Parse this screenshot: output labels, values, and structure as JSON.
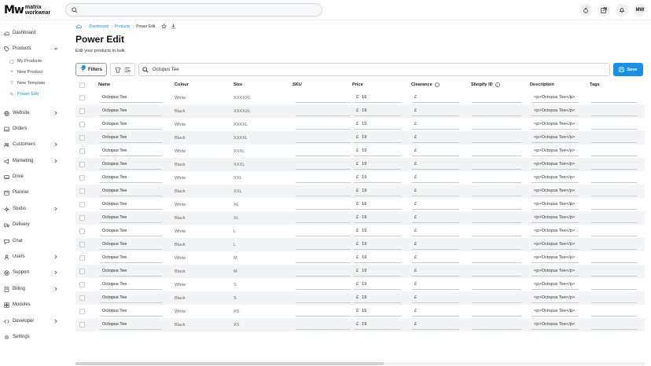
{
  "brand": {
    "mark": "Mw",
    "line1": "matrix",
    "line2": "workwear"
  },
  "header": {
    "avatar": "MW",
    "icons": [
      "ai-icon",
      "external-link-icon",
      "bell-icon"
    ]
  },
  "sidebar": {
    "items": [
      {
        "label": "Dashboard",
        "icon": "cloud-icon"
      },
      {
        "label": "Products",
        "icon": "tag-icon",
        "expanded": true
      },
      {
        "label": "Website",
        "icon": "globe-icon",
        "chevron": true
      },
      {
        "label": "Orders",
        "icon": "inbox-icon"
      },
      {
        "label": "Customers",
        "icon": "customers-icon",
        "chevron": true
      },
      {
        "label": "Marketing",
        "icon": "megaphone-icon",
        "chevron": true
      },
      {
        "label": "Drive",
        "icon": "drive-icon"
      },
      {
        "label": "Planner",
        "icon": "calendar-icon"
      },
      {
        "label": "Studio",
        "icon": "studio-icon",
        "chevron": true
      },
      {
        "label": "Delivery",
        "icon": "truck-icon"
      },
      {
        "label": "Chat",
        "icon": "chat-icon"
      },
      {
        "label": "Users",
        "icon": "users-icon",
        "chevron": true
      },
      {
        "label": "Support",
        "icon": "support-icon",
        "chevron": true
      },
      {
        "label": "Billing",
        "icon": "billing-icon",
        "chevron": true
      },
      {
        "label": "Modules",
        "icon": "modules-icon"
      },
      {
        "label": "Developer",
        "icon": "code-icon",
        "chevron": true
      },
      {
        "label": "Settings",
        "icon": "gear-icon"
      }
    ],
    "products_sub": [
      {
        "label": "My Products",
        "icon": "box-icon"
      },
      {
        "label": "New Product",
        "icon": "plus-icon"
      },
      {
        "label": "New Template",
        "icon": "template-icon"
      },
      {
        "label": "Power Edit",
        "icon": "power-edit-icon",
        "active": true
      }
    ]
  },
  "breadcrumb": {
    "home_icon": "cloud-icon",
    "items": [
      "Dashboard",
      "Products"
    ],
    "current": "Power Edit"
  },
  "page": {
    "title": "Power Edit",
    "subtitle": "Edit your products in bulk"
  },
  "toolbar": {
    "filters_label": "Filters",
    "filters_badge": "1",
    "search_value": "Octopus Tee",
    "save_label": "Save"
  },
  "table": {
    "columns": [
      "Name",
      "Colour",
      "Size",
      "SKU",
      "Price",
      "Clearance",
      "Shopify ID",
      "Description",
      "Tags"
    ],
    "currency": "£",
    "rows": [
      {
        "name": "Octopus Tee",
        "colour": "White",
        "size": "XXXXXL",
        "price": "19",
        "clearance": "",
        "description": "<p>Octopus Tee</p>"
      },
      {
        "name": "Octopus Tee",
        "colour": "Black",
        "size": "XXXXXL",
        "price": "19",
        "clearance": "",
        "description": "<p>Octopus Tee</p>"
      },
      {
        "name": "Octopus Tee",
        "colour": "White",
        "size": "XXXXL",
        "price": "19",
        "clearance": "",
        "description": "<p>Octopus Tee</p>"
      },
      {
        "name": "Octopus Tee",
        "colour": "Black",
        "size": "XXXXL",
        "price": "19",
        "clearance": "",
        "description": "<p>Octopus Tee</p>"
      },
      {
        "name": "Octopus Tee",
        "colour": "White",
        "size": "XXXL",
        "price": "19",
        "clearance": "",
        "description": "<p>Octopus Tee</p>"
      },
      {
        "name": "Octopus Tee",
        "colour": "Black",
        "size": "XXXL",
        "price": "19",
        "clearance": "",
        "description": "<p>Octopus Tee</p>"
      },
      {
        "name": "Octopus Tee",
        "colour": "White",
        "size": "XXL",
        "price": "19",
        "clearance": "",
        "description": "<p>Octopus Tee</p>"
      },
      {
        "name": "Octopus Tee",
        "colour": "Black",
        "size": "XXL",
        "price": "19",
        "clearance": "",
        "description": "<p>Octopus Tee</p>"
      },
      {
        "name": "Octopus Tee",
        "colour": "White",
        "size": "XL",
        "price": "19",
        "clearance": "",
        "description": "<p>Octopus Tee</p>"
      },
      {
        "name": "Octopus Tee",
        "colour": "Black",
        "size": "XL",
        "price": "19",
        "clearance": "",
        "description": "<p>Octopus Tee</p>"
      },
      {
        "name": "Octopus Tee",
        "colour": "White",
        "size": "L",
        "price": "19",
        "clearance": "",
        "description": "<p>Octopus Tee</p>"
      },
      {
        "name": "Octopus Tee",
        "colour": "Black",
        "size": "L",
        "price": "19",
        "clearance": "",
        "description": "<p>Octopus Tee</p>"
      },
      {
        "name": "Octopus Tee",
        "colour": "White",
        "size": "M",
        "price": "19",
        "clearance": "",
        "description": "<p>Octopus Tee</p>"
      },
      {
        "name": "Octopus Tee",
        "colour": "Black",
        "size": "M",
        "price": "19",
        "clearance": "",
        "description": "<p>Octopus Tee</p>"
      },
      {
        "name": "Octopus Tee",
        "colour": "White",
        "size": "S",
        "price": "19",
        "clearance": "",
        "description": "<p>Octopus Tee</p>"
      },
      {
        "name": "Octopus Tee",
        "colour": "Black",
        "size": "S",
        "price": "19",
        "clearance": "",
        "description": "<p>Octopus Tee</p>"
      },
      {
        "name": "Octopus Tee",
        "colour": "White",
        "size": "XS",
        "price": "19",
        "clearance": "",
        "description": "<p>Octopus Tee</p>"
      },
      {
        "name": "Octopus Tee",
        "colour": "Black",
        "size": "XS",
        "price": "19",
        "clearance": "",
        "description": "<p>Octopus Tee</p>"
      }
    ]
  },
  "colors": {
    "accent": "#1a8fe3",
    "row_alt": "#f3f4f6"
  }
}
